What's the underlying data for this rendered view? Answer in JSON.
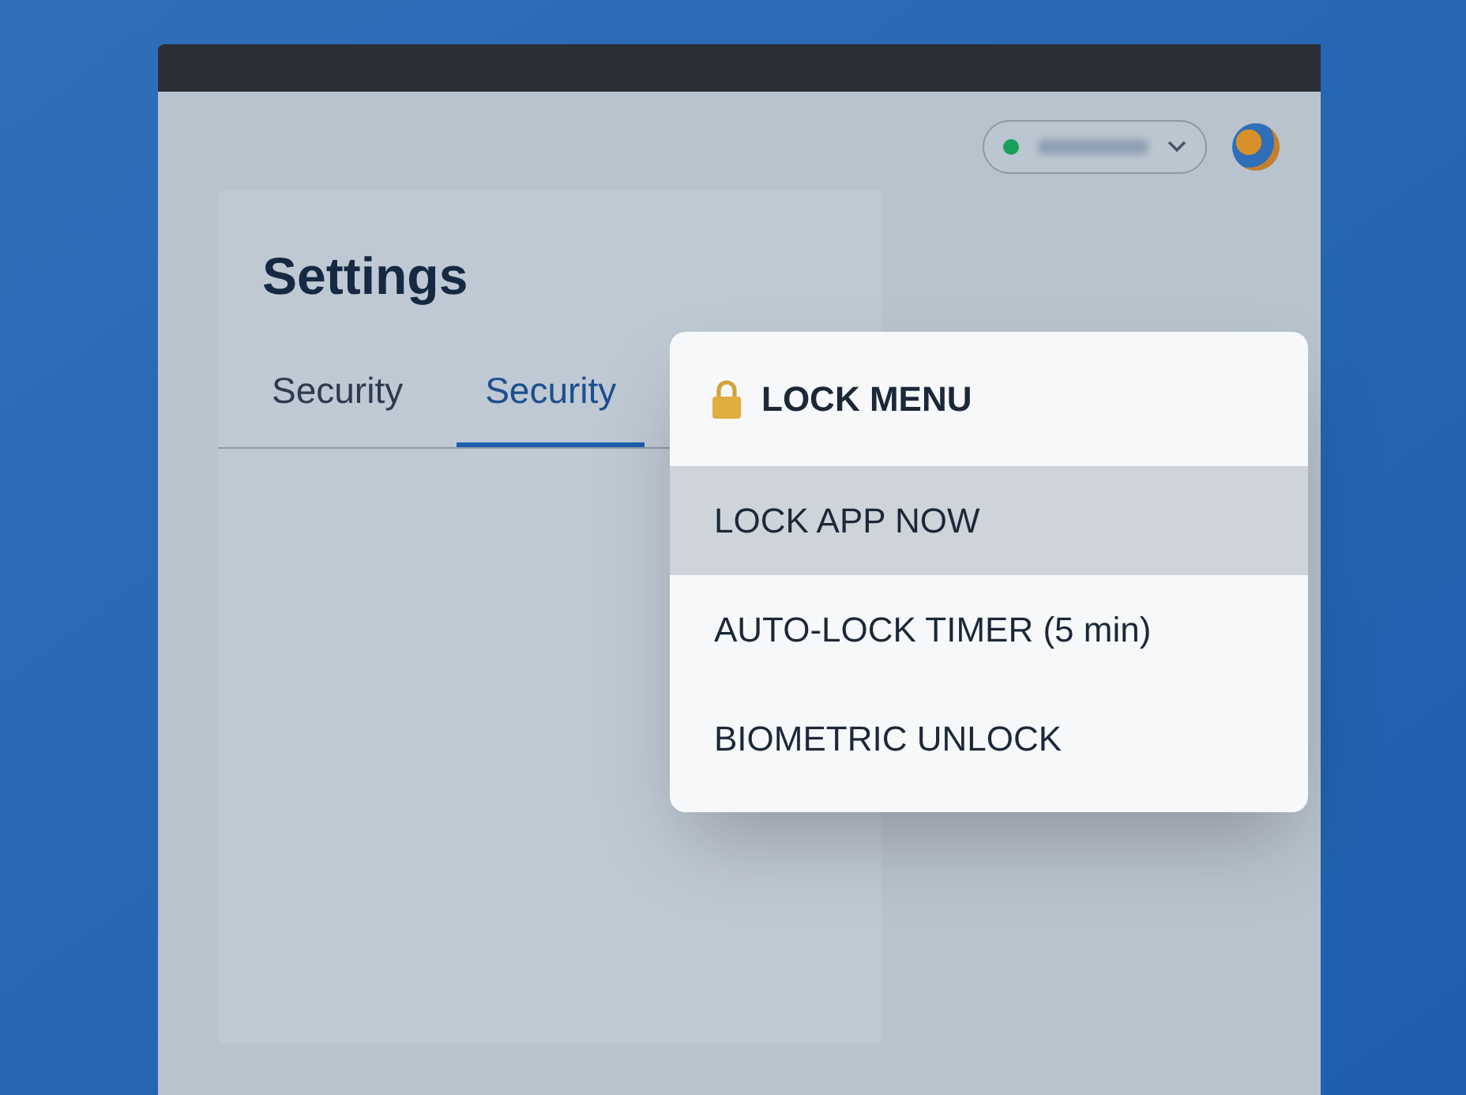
{
  "header": {
    "status": {
      "online": true
    }
  },
  "settings": {
    "title": "Settings",
    "tabs": [
      {
        "label": "Security",
        "selected": false
      },
      {
        "label": "Security",
        "selected": true
      }
    ]
  },
  "lock_menu": {
    "title": "LOCK MENU",
    "items": [
      {
        "label": "LOCK APP NOW",
        "selected": true
      },
      {
        "label": "AUTO-LOCK TIMER (5 min)",
        "selected": false
      },
      {
        "label": "BIOMETRIC UNLOCK",
        "selected": false
      }
    ]
  }
}
